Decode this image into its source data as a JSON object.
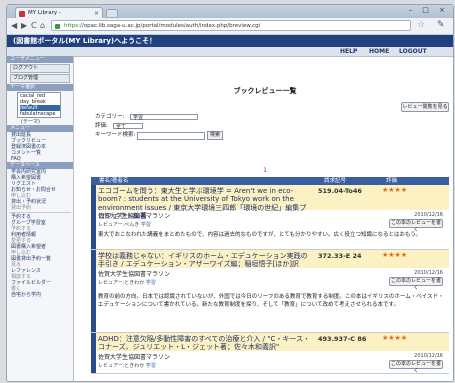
{
  "browser": {
    "tab_title": "MY Library -",
    "tab_close": "×",
    "window_controls": "– □ ×",
    "back": "◀",
    "forward": "▶",
    "reload": "C",
    "home": "⌂",
    "url_scheme": "https",
    "url_rest": "://opac.lib.saga-u.ac.jp/portal/modules/auth/index.php/breview.cgi",
    "star": "☆",
    "wrench": "✎"
  },
  "site": {
    "banner": "(図書館ポータル(MY Library)へようこそ！",
    "topnav": [
      "HELP",
      "HOME",
      "LOGOUT"
    ]
  },
  "sidebar": {
    "user_menu_header": "ユーザメニュー",
    "logout_btn": "ログアウト",
    "blog_btn": "ブログ管理",
    "theme_header": "テーマ選択",
    "theme_options": [
      "cacial_red",
      "day_break",
      "default",
      "fabulatnscape"
    ],
    "theme_selected_index": 2,
    "theme_note": "(テーマ)",
    "menu_header": "メニュー",
    "links": [
      "貸出延長",
      "ブックリビュー",
      "登録済図書の本",
      "コメント一覧",
      "FAQ"
    ],
    "data_header": "データベース",
    "links2": [
      "学会内研究室内",
      "購入希望図書",
      "リクエスト",
      "お知らせ・お問合せ",
      "申し込む",
      "貸出・予約状況",
      "貸出予約"
    ],
    "links3": [
      "予約する",
      "グループ学習室",
      "予約する",
      "利用者情報",
      "変更する",
      "図書購入希望者",
      "申し込む",
      "図書貸出予約一覧",
      "見る",
      "レファレンス",
      "相談する",
      "ファイルビルダー",
      "書く",
      "自宅から学内"
    ]
  },
  "main": {
    "page_title": "ブックレビュー一覧",
    "all_reviews_btn": "レビュー閲覧を見る",
    "category_label": "カテゴリー:",
    "category_value": "学習",
    "rating_label": "評価:",
    "rating_value": "全て",
    "keyword_label": "キーワード検索:",
    "search_btn": "検索",
    "pager": "1",
    "table_headers": [
      "書名/著者名",
      "請求記号",
      "評価"
    ]
  },
  "records": [
    {
      "title": "エコゴームを問う：東大生と学ぶ環境学 = Aren't we in eco-boom? : students at the University of Tokyo work on the environment issues / 東京大学環境三四郎「環境の世紀」編集プロジェクト編著",
      "call_no": "519.04-To46",
      "stars": "★★★★",
      "reviewer": "佐賀大学生協図書マラソン",
      "by": "レビュアー:ぺんき",
      "by_tag": "学習",
      "date": "2010/12/16",
      "look_btn": "この本のレビューを書く",
      "text": "東大でおこなわれた講義をまとめたもので、内容は過去的なものですが、とても分かりやすい。広く役立つ知識になるとはおもう。"
    },
    {
      "title": "学校は義務じゃない：イギリスのホーム・エデュケーション実践の手引き / エデュケーション・アザーワイズ編；稲垣悟子[ほか]訳",
      "call_no": "372.33-E 24",
      "stars": "★★★★",
      "reviewer": "佐賀大学生協図書マラソン",
      "by": "レビュアー:ときわか",
      "by_tag": "学習",
      "date": "2010/12/16",
      "look_btn": "この本のレビューを書く",
      "text": "教育の前の方向。日本では認識されていないが、外国では今日のリーフのある教育で教育する制度。この本はイギリスのホーム・ベイスド・エデュケーションについて書かれている。新たな教育制度を探り、そして「教育」について改めて考えさせられる本です。"
    },
    {
      "title": "ADHD：注意欠陥/多動性障害のすべての治療と介入 / \"C・キース・コナーズ、ジュリエット・L・ジェット著；佐々木和義訳\"",
      "call_no": "493.937-C 86",
      "stars": "★★★★",
      "reviewer": "佐賀大学生協図書マラソン",
      "by": "レビュアー:ときわか",
      "by_tag": "学習",
      "date": "2010/12/16",
      "look_btn": "この本のレビューを書く",
      "text": ""
    }
  ],
  "colors": {
    "banner": "#21407f",
    "title_bg": "#fbf1c3",
    "stars": "#e06a1a",
    "stripe": "#2b4c8c"
  }
}
